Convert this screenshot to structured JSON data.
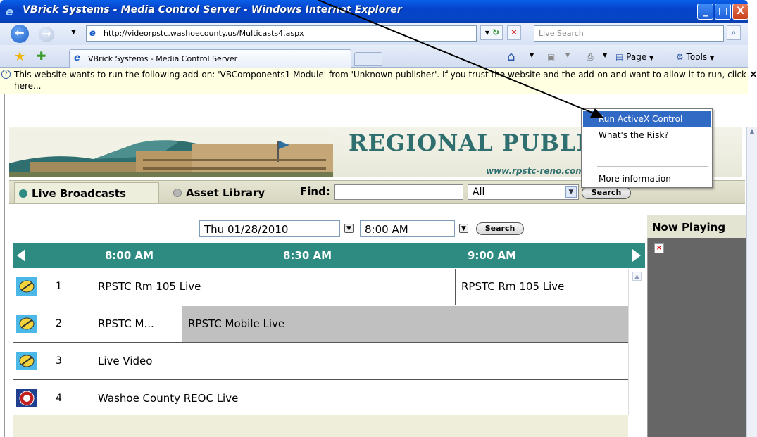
{
  "window": {
    "title": "VBrick Systems - Media Control Server - Windows Internet Explorer",
    "controls": [
      "_",
      "□",
      "X"
    ]
  },
  "address_bar": {
    "url": "http://videorpstc.washoecounty.us/Multicasts4.aspx",
    "search_placeholder": "Live Search"
  },
  "tabs": {
    "active_label": "VBrick Systems - Media Control Server"
  },
  "command_bar": {
    "page_label": "Page",
    "tools_label": "Tools"
  },
  "info_bar": {
    "message": "This website wants to run the following add-on: 'VBComponents1 Module' from 'Unknown publisher'. If you trust the website and the add-on and want to allow it to run, click here...",
    "close_glyph": "×"
  },
  "context_menu": {
    "items": [
      "Run ActiveX Control",
      "What's the Risk?",
      "More information"
    ]
  },
  "banner": {
    "title": "REGIONAL PUBLIC      TR",
    "url": "www.rpstc-reno.com"
  },
  "nav": {
    "live_label": "Live Broadcasts",
    "library_label": "Asset Library",
    "find_label": "Find:",
    "find_value": "",
    "scope_value": "All",
    "search_label": "Search"
  },
  "schedule": {
    "date": "Thu 01/28/2010",
    "time": "8:00 AM",
    "search_label": "Search",
    "time_headers": [
      "8:00 AM",
      "8:30 AM",
      "9:00 AM"
    ],
    "rows": [
      {
        "num": "1",
        "cells": [
          "RPSTC Rm 105 Live",
          "RPSTC Rm 105 Live"
        ]
      },
      {
        "num": "2",
        "cells": [
          "RPSTC M...",
          "RPSTC Mobile Live"
        ]
      },
      {
        "num": "3",
        "cells": [
          "Live Video"
        ]
      },
      {
        "num": "4",
        "cells": [
          "Washoe County REOC Live"
        ]
      }
    ]
  },
  "now_playing": {
    "title": "Now Playing",
    "broken_glyph": "×"
  },
  "colors": {
    "accent_teal": "#2d8b82",
    "menu_highlight": "#316ac5",
    "titlebar_blue": "#0543c9"
  },
  "icons": [
    "ie-icon",
    "back-icon",
    "forward-icon",
    "refresh-icon",
    "stop-icon",
    "search-icon",
    "favorites-star-icon",
    "add-favorites-icon",
    "home-icon",
    "feeds-icon",
    "print-icon",
    "page-icon",
    "tools-gear-icon",
    "info-question-icon",
    "satellite-icon",
    "county-seal-icon"
  ]
}
